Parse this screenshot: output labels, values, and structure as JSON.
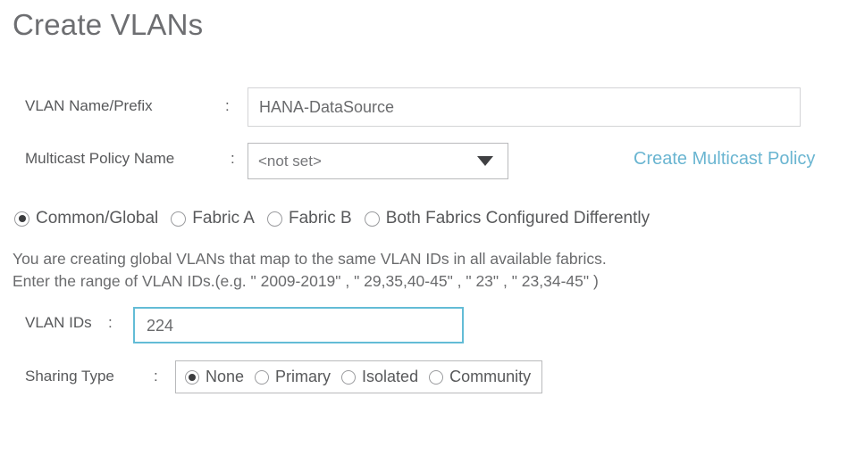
{
  "dialog": {
    "title": "Create VLANs"
  },
  "vlan_name": {
    "label": "VLAN Name/Prefix",
    "colon": ":",
    "value": "HANA-DataSource",
    "placeholder": ""
  },
  "multicast_policy": {
    "label": "Multicast Policy Name",
    "colon": ":",
    "selected": "<not set>",
    "options": [
      "<not set>"
    ],
    "arrow_icon": "chevron-down-icon",
    "create_link": "Create Multicast Policy",
    "link_color": "#6ab5d1"
  },
  "fabric_scope": {
    "options": [
      {
        "label": "Common/Global",
        "checked": true
      },
      {
        "label": "Fabric A",
        "checked": false
      },
      {
        "label": "Fabric B",
        "checked": false
      },
      {
        "label": "Both Fabrics Configured Differently",
        "checked": false
      }
    ]
  },
  "description": {
    "line1": "You are creating global VLANs that map to the same VLAN IDs in all available fabrics.",
    "line2": "Enter the range of VLAN IDs.(e.g. \" 2009-2019\" , \" 29,35,40-45\" , \" 23\" , \" 23,34-45\" )"
  },
  "vlan_ids": {
    "label": "VLAN IDs",
    "colon": ":",
    "value": "224",
    "placeholder": "",
    "focus_border_color": "#63bcd6"
  },
  "sharing_type": {
    "label": "Sharing Type",
    "colon": ":",
    "options": [
      {
        "label": "None",
        "checked": true
      },
      {
        "label": "Primary",
        "checked": false
      },
      {
        "label": "Isolated",
        "checked": false
      },
      {
        "label": "Community",
        "checked": false
      }
    ]
  }
}
